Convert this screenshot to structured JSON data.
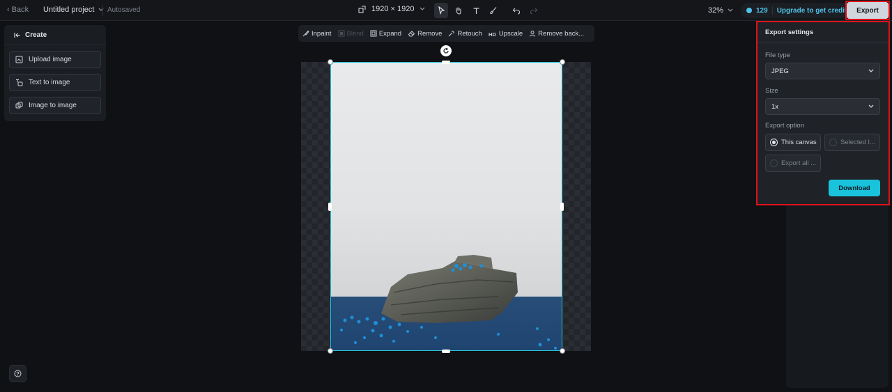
{
  "topbar": {
    "back_label": "Back",
    "project_name": "Untitled project",
    "autosaved": "Autosaved",
    "dimensions": "1920 × 1920",
    "zoom": "32%",
    "credits_count": "129",
    "upgrade_label": "Upgrade to get credits",
    "export_label": "Export"
  },
  "create_panel": {
    "title": "Create",
    "items": [
      {
        "label": "Upload image",
        "icon": "upload-image-icon"
      },
      {
        "label": "Text to image",
        "icon": "text-to-image-icon"
      },
      {
        "label": "Image to image",
        "icon": "image-to-image-icon"
      }
    ]
  },
  "edit_toolbar": {
    "items": [
      {
        "label": "Inpaint",
        "enabled": true
      },
      {
        "label": "Blend",
        "enabled": false
      },
      {
        "label": "Expand",
        "enabled": true
      },
      {
        "label": "Remove",
        "enabled": true
      },
      {
        "label": "Retouch",
        "enabled": true
      },
      {
        "label": "Upscale",
        "enabled": true
      },
      {
        "label": "Remove back...",
        "enabled": true
      }
    ]
  },
  "export_settings": {
    "title": "Export settings",
    "file_type_label": "File type",
    "file_type_value": "JPEG",
    "size_label": "Size",
    "size_value": "1x",
    "export_option_label": "Export option",
    "options": [
      {
        "label": "This canvas",
        "selected": true
      },
      {
        "label": "Selected l...",
        "selected": false
      },
      {
        "label": "Export all ...",
        "selected": false
      }
    ],
    "download_label": "Download"
  },
  "colors": {
    "accent": "#19c3dc",
    "highlight": "#e0121b",
    "background": "#0f1114"
  }
}
